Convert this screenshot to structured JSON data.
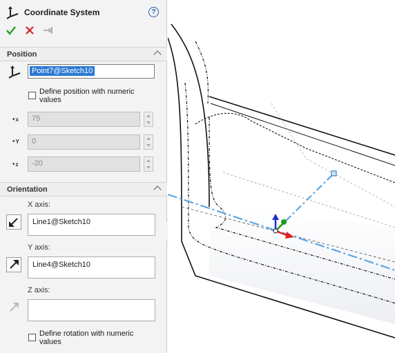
{
  "header": {
    "title": "Coordinate System",
    "help_glyph": "?"
  },
  "toolbar": {
    "ok_icon": "check-icon",
    "cancel_icon": "x-icon",
    "pin_icon": "pushpin-icon"
  },
  "position": {
    "section_label": "Position",
    "origin_value": "Point7@Sketch10",
    "define_numeric_label": "Define position with numeric values",
    "define_numeric_checked": false,
    "x_label": "x",
    "x_value": "75",
    "y_label": "Y",
    "y_value": "0",
    "z_label": "z",
    "z_value": "-20"
  },
  "orientation": {
    "section_label": "Orientation",
    "x_axis_label": "X axis:",
    "x_axis_value": "Line1@Sketch10",
    "y_axis_label": "Y axis:",
    "y_axis_value": "Line4@Sketch10",
    "z_axis_label": "Z axis:",
    "z_axis_value": "",
    "define_rotation_label": "Define rotation with numeric values",
    "define_rotation_checked": false
  },
  "colors": {
    "check": "#2e9e2e",
    "cancel": "#d32020",
    "selection": "#2a78d4",
    "sketch_line": "#5aa7e8",
    "triad_x": "#e02020",
    "triad_y": "#1a9a1a",
    "triad_z": "#1e2fd0"
  }
}
